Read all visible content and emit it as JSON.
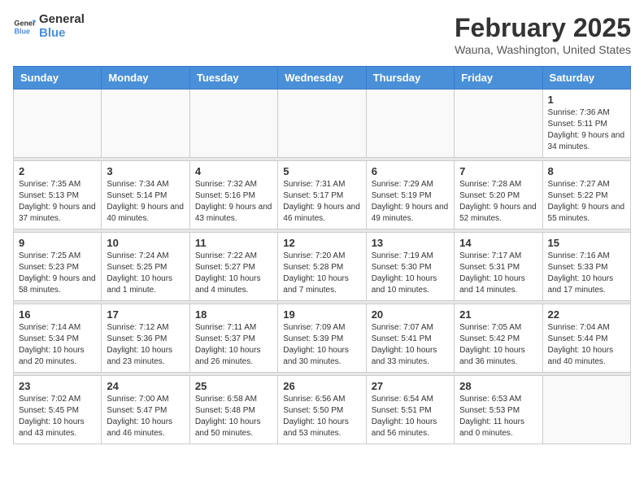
{
  "header": {
    "logo_line1": "General",
    "logo_line2": "Blue",
    "month_year": "February 2025",
    "location": "Wauna, Washington, United States"
  },
  "weekdays": [
    "Sunday",
    "Monday",
    "Tuesday",
    "Wednesday",
    "Thursday",
    "Friday",
    "Saturday"
  ],
  "weeks": [
    [
      {
        "day": "",
        "info": ""
      },
      {
        "day": "",
        "info": ""
      },
      {
        "day": "",
        "info": ""
      },
      {
        "day": "",
        "info": ""
      },
      {
        "day": "",
        "info": ""
      },
      {
        "day": "",
        "info": ""
      },
      {
        "day": "1",
        "info": "Sunrise: 7:36 AM\nSunset: 5:11 PM\nDaylight: 9 hours and 34 minutes."
      }
    ],
    [
      {
        "day": "2",
        "info": "Sunrise: 7:35 AM\nSunset: 5:13 PM\nDaylight: 9 hours and 37 minutes."
      },
      {
        "day": "3",
        "info": "Sunrise: 7:34 AM\nSunset: 5:14 PM\nDaylight: 9 hours and 40 minutes."
      },
      {
        "day": "4",
        "info": "Sunrise: 7:32 AM\nSunset: 5:16 PM\nDaylight: 9 hours and 43 minutes."
      },
      {
        "day": "5",
        "info": "Sunrise: 7:31 AM\nSunset: 5:17 PM\nDaylight: 9 hours and 46 minutes."
      },
      {
        "day": "6",
        "info": "Sunrise: 7:29 AM\nSunset: 5:19 PM\nDaylight: 9 hours and 49 minutes."
      },
      {
        "day": "7",
        "info": "Sunrise: 7:28 AM\nSunset: 5:20 PM\nDaylight: 9 hours and 52 minutes."
      },
      {
        "day": "8",
        "info": "Sunrise: 7:27 AM\nSunset: 5:22 PM\nDaylight: 9 hours and 55 minutes."
      }
    ],
    [
      {
        "day": "9",
        "info": "Sunrise: 7:25 AM\nSunset: 5:23 PM\nDaylight: 9 hours and 58 minutes."
      },
      {
        "day": "10",
        "info": "Sunrise: 7:24 AM\nSunset: 5:25 PM\nDaylight: 10 hours and 1 minute."
      },
      {
        "day": "11",
        "info": "Sunrise: 7:22 AM\nSunset: 5:27 PM\nDaylight: 10 hours and 4 minutes."
      },
      {
        "day": "12",
        "info": "Sunrise: 7:20 AM\nSunset: 5:28 PM\nDaylight: 10 hours and 7 minutes."
      },
      {
        "day": "13",
        "info": "Sunrise: 7:19 AM\nSunset: 5:30 PM\nDaylight: 10 hours and 10 minutes."
      },
      {
        "day": "14",
        "info": "Sunrise: 7:17 AM\nSunset: 5:31 PM\nDaylight: 10 hours and 14 minutes."
      },
      {
        "day": "15",
        "info": "Sunrise: 7:16 AM\nSunset: 5:33 PM\nDaylight: 10 hours and 17 minutes."
      }
    ],
    [
      {
        "day": "16",
        "info": "Sunrise: 7:14 AM\nSunset: 5:34 PM\nDaylight: 10 hours and 20 minutes."
      },
      {
        "day": "17",
        "info": "Sunrise: 7:12 AM\nSunset: 5:36 PM\nDaylight: 10 hours and 23 minutes."
      },
      {
        "day": "18",
        "info": "Sunrise: 7:11 AM\nSunset: 5:37 PM\nDaylight: 10 hours and 26 minutes."
      },
      {
        "day": "19",
        "info": "Sunrise: 7:09 AM\nSunset: 5:39 PM\nDaylight: 10 hours and 30 minutes."
      },
      {
        "day": "20",
        "info": "Sunrise: 7:07 AM\nSunset: 5:41 PM\nDaylight: 10 hours and 33 minutes."
      },
      {
        "day": "21",
        "info": "Sunrise: 7:05 AM\nSunset: 5:42 PM\nDaylight: 10 hours and 36 minutes."
      },
      {
        "day": "22",
        "info": "Sunrise: 7:04 AM\nSunset: 5:44 PM\nDaylight: 10 hours and 40 minutes."
      }
    ],
    [
      {
        "day": "23",
        "info": "Sunrise: 7:02 AM\nSunset: 5:45 PM\nDaylight: 10 hours and 43 minutes."
      },
      {
        "day": "24",
        "info": "Sunrise: 7:00 AM\nSunset: 5:47 PM\nDaylight: 10 hours and 46 minutes."
      },
      {
        "day": "25",
        "info": "Sunrise: 6:58 AM\nSunset: 5:48 PM\nDaylight: 10 hours and 50 minutes."
      },
      {
        "day": "26",
        "info": "Sunrise: 6:56 AM\nSunset: 5:50 PM\nDaylight: 10 hours and 53 minutes."
      },
      {
        "day": "27",
        "info": "Sunrise: 6:54 AM\nSunset: 5:51 PM\nDaylight: 10 hours and 56 minutes."
      },
      {
        "day": "28",
        "info": "Sunrise: 6:53 AM\nSunset: 5:53 PM\nDaylight: 11 hours and 0 minutes."
      },
      {
        "day": "",
        "info": ""
      }
    ]
  ]
}
